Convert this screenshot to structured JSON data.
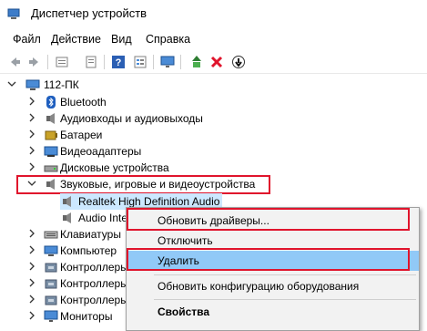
{
  "window": {
    "title": "Диспетчер устройств"
  },
  "menu": [
    "Файл",
    "Действие",
    "Вид",
    "Справка"
  ],
  "toolbar": {
    "icons": [
      "back-icon",
      "forward-icon",
      "properties-icon",
      "view-icon",
      "help-icon",
      "details-icon",
      "monitor-icon",
      "update-driver-icon",
      "uninstall-icon",
      "disable-icon"
    ],
    "accent_red": "#e0142c"
  },
  "tree": {
    "root": "112-ПК",
    "items": [
      {
        "label": "Bluetooth",
        "icon": "bluetooth-icon"
      },
      {
        "label": "Аудиовходы и аудиовыходы",
        "icon": "speaker-icon"
      },
      {
        "label": "Батареи",
        "icon": "battery-icon"
      },
      {
        "label": "Видеоадаптеры",
        "icon": "display-adapter-icon"
      },
      {
        "label": "Дисковые устройства",
        "icon": "disk-icon"
      },
      {
        "label": "Звуковые, игровые и видеоустройства",
        "icon": "sound-icon",
        "expanded": true
      },
      {
        "label": "Realtek High Definition Audio",
        "icon": "speaker-icon",
        "child": true,
        "selected": true
      },
      {
        "label": "Audio Inte",
        "icon": "speaker-icon",
        "child": true
      },
      {
        "label": "Клавиатуры",
        "icon": "keyboard-icon"
      },
      {
        "label": "Компьютер",
        "icon": "computer-icon"
      },
      {
        "label": "Контроллеры",
        "icon": "controller-icon"
      },
      {
        "label": "Контроллеры",
        "icon": "controller-icon"
      },
      {
        "label": "Контроллеры",
        "icon": "controller-icon"
      },
      {
        "label": "Мониторы",
        "icon": "monitor-icon"
      }
    ]
  },
  "context_menu": {
    "update": "Обновить драйверы...",
    "disable": "Отключить",
    "uninstall": "Удалить",
    "scan": "Обновить конфигурацию оборудования",
    "properties": "Свойства"
  }
}
